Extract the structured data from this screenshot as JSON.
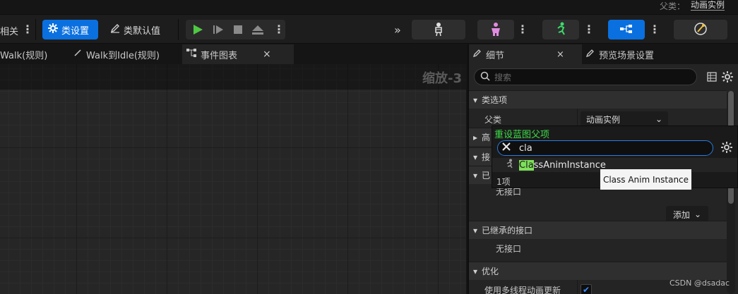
{
  "top": {
    "parent_label": "父类：",
    "parent_value": "动画实例"
  },
  "toolbar": {
    "left_label": "相关",
    "class_settings": "类设置",
    "class_defaults": "类默认值"
  },
  "tabs": [
    {
      "label": "Walk(规则)"
    },
    {
      "label": "Walk到Idle(规则)"
    },
    {
      "label": "事件图表",
      "close": "×"
    }
  ],
  "graph": {
    "zoom": "缩放-3"
  },
  "panel": {
    "tabs": [
      {
        "label": "细节",
        "close": "×"
      },
      {
        "label": "预览场景设置"
      }
    ],
    "search_placeholder": "搜索",
    "categories": {
      "class_options": "类选项",
      "advanced": "高",
      "interfaces": "接",
      "implemented": "已",
      "inherited_interfaces": "已继承的接口",
      "optimization": "优化"
    },
    "parent_class_label": "父类",
    "parent_class_value": "动画实例",
    "no_interface_1": "无接口",
    "no_interface_2": "无接口",
    "add_button": "添加",
    "multithread_label": "使用多线程动画更新",
    "multithread_checked": true
  },
  "popup": {
    "title": "重设蓝图父项",
    "search_value": "cla",
    "result_match": "Cla",
    "result_rest": "ssAnimInstance",
    "count": "1项"
  },
  "tooltip": "Class Anim Instance",
  "watermark": "CSDN @dsadac",
  "colors": {
    "accent": "#0a70e0",
    "green_title": "#3ddc4a",
    "highlight": "#7ee05a"
  }
}
